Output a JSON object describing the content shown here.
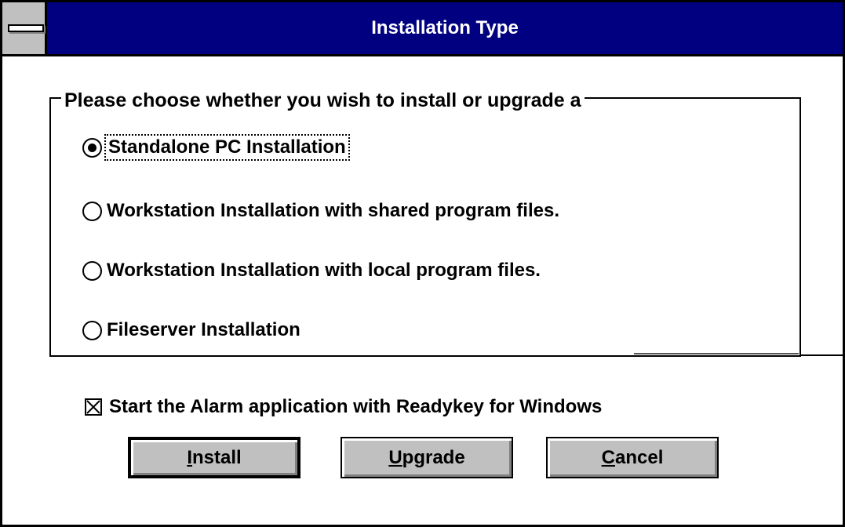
{
  "window": {
    "title": "Installation Type"
  },
  "group": {
    "legend": "Please choose whether you wish to install or upgrade a",
    "options": [
      {
        "label": "Standalone PC Installation",
        "selected": true
      },
      {
        "label": "Workstation Installation with shared program files.",
        "selected": false
      },
      {
        "label": "Workstation Installation with local program files.",
        "selected": false
      },
      {
        "label": "Fileserver Installation",
        "selected": false
      }
    ]
  },
  "checkbox": {
    "label": "Start the Alarm application with Readykey for Windows",
    "checked": true
  },
  "buttons": {
    "install": {
      "mnemonic": "I",
      "rest": "nstall"
    },
    "upgrade": {
      "mnemonic": "U",
      "rest": "pgrade"
    },
    "cancel": {
      "mnemonic": "C",
      "rest": "ancel"
    }
  },
  "colors": {
    "titlebar": "#000080",
    "button_face": "#c0c0c0"
  },
  "icons": {
    "system_menu": "system-menu-icon",
    "radio": "radio-button-icon",
    "checkbox": "checkbox-x-icon"
  }
}
